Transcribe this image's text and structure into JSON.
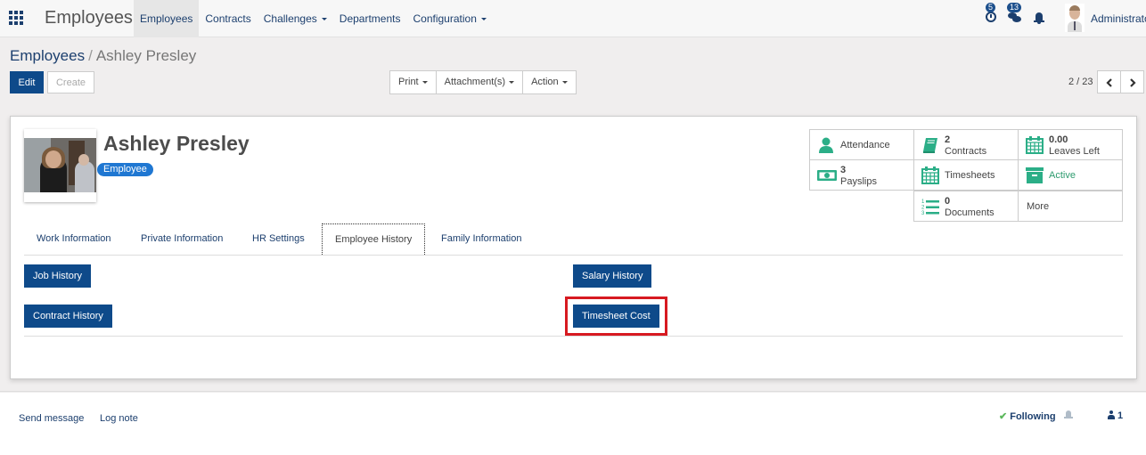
{
  "navbar": {
    "app_title": "Employees",
    "menu": [
      {
        "label": "Employees",
        "active": true,
        "dropdown": false
      },
      {
        "label": "Contracts",
        "active": false,
        "dropdown": false
      },
      {
        "label": "Challenges",
        "active": false,
        "dropdown": true
      },
      {
        "label": "Departments",
        "active": false,
        "dropdown": false
      },
      {
        "label": "Configuration",
        "active": false,
        "dropdown": true
      }
    ],
    "activity_count": "5",
    "message_count": "13",
    "user_name": "Administrator"
  },
  "control_panel": {
    "breadcrumb": {
      "parent": "Employees",
      "separator": "/",
      "current": "Ashley Presley"
    },
    "edit_label": "Edit",
    "create_label": "Create",
    "print_label": "Print",
    "attachments_label": "Attachment(s)",
    "action_label": "Action",
    "pager": "2 / 23"
  },
  "employee": {
    "name": "Ashley Presley",
    "tag": "Employee"
  },
  "smart_buttons": {
    "attendance": {
      "label": "Attendance"
    },
    "contracts": {
      "value": "2",
      "label": "Contracts"
    },
    "leaves": {
      "value": "0.00",
      "label": "Leaves Left"
    },
    "payslips": {
      "value": "3",
      "label": "Payslips"
    },
    "timesheets": {
      "label": "Timesheets"
    },
    "active": {
      "label": "Active"
    },
    "documents": {
      "value": "0",
      "label": "Documents"
    },
    "more": {
      "label": "More"
    }
  },
  "tabs": [
    {
      "label": "Work Information",
      "active": false
    },
    {
      "label": "Private Information",
      "active": false
    },
    {
      "label": "HR Settings",
      "active": false
    },
    {
      "label": "Employee History",
      "active": true
    },
    {
      "label": "Family Information",
      "active": false
    }
  ],
  "history_buttons": {
    "job_history": "Job History",
    "contract_history": "Contract History",
    "salary_history": "Salary History",
    "timesheet_cost": "Timesheet Cost"
  },
  "chatter": {
    "send_message": "Send message",
    "log_note": "Log note",
    "following": "Following",
    "followers_count": "1"
  },
  "colors": {
    "primary": "#0e4a8a",
    "link": "#1c3f6e",
    "accent_green": "#2d9b6e",
    "highlight_red": "#d71a21",
    "tag_blue": "#1f77d2"
  }
}
